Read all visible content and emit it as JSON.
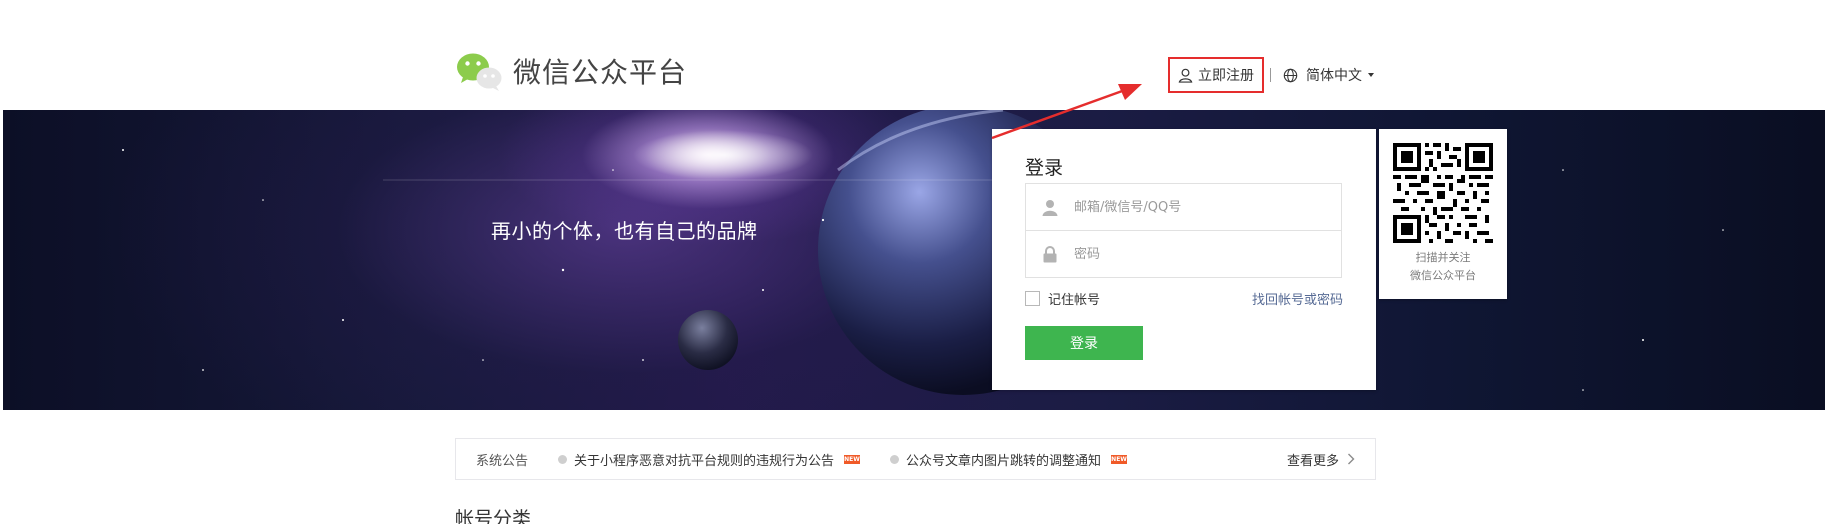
{
  "header": {
    "logo_text": "微信公众平台",
    "register_label": "立即注册",
    "language_label": "简体中文",
    "icons": {
      "logo": "wechat-logo-icon",
      "register": "user-icon",
      "language": "globe-icon",
      "dropdown": "caret-down-icon"
    }
  },
  "banner": {
    "slogan": "再小的个体，也有自己的品牌"
  },
  "login": {
    "title": "登录",
    "account_placeholder": "邮箱/微信号/QQ号",
    "password_placeholder": "密码",
    "remember_label": "记住帐号",
    "forgot_label": "找回帐号或密码",
    "submit_label": "登录",
    "submit_color": "#3eb54f",
    "icons": {
      "account": "user-icon",
      "password": "lock-icon"
    }
  },
  "qr": {
    "caption_line1": "扫描并关注",
    "caption_line2": "微信公众平台"
  },
  "notice": {
    "label": "系统公告",
    "items": [
      {
        "text": "关于小程序恶意对抗平台规则的违规行为公告",
        "badge": "NEW"
      },
      {
        "text": "公众号文章内图片跳转的调整通知",
        "badge": "NEW"
      }
    ],
    "more_label": "查看更多"
  },
  "section": {
    "title": "帐号分类"
  },
  "annotation": {
    "color": "#e52d2d"
  }
}
